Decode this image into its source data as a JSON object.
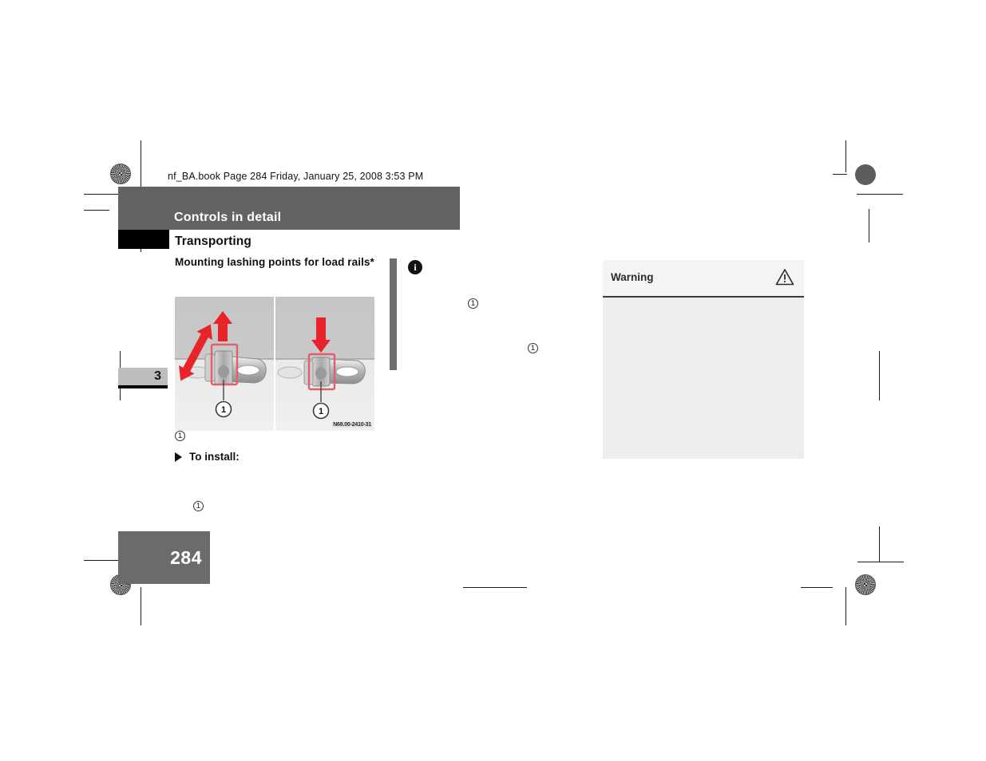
{
  "document": {
    "running_head": "nf_BA.book  Page 284  Friday, January 25, 2008  3:53 PM",
    "chapter_banner_title": "Controls in detail",
    "section_title": "Transporting",
    "chapter_thumb_number": "3",
    "page_number": "284"
  },
  "content": {
    "subheading": "Mounting lashing points for load rails*",
    "figure": {
      "code": "N68.00-2410-31",
      "panels": [
        {
          "name": "tilt-and-lift-panel",
          "callout": "1",
          "arrows": [
            "diagonal-double-arrow",
            "up-arrow"
          ]
        },
        {
          "name": "press-down-panel",
          "callout": "1",
          "arrows": [
            "down-arrow"
          ]
        }
      ]
    },
    "legend_marker": "1",
    "step_label": "To install:",
    "lower_marker": "1"
  },
  "notice": {
    "icon": "i",
    "marker_a": "1",
    "marker_b": "1"
  },
  "warning": {
    "title": "Warning",
    "icon": "warning-triangle-icon"
  },
  "colors": {
    "banner_gray": "#636363",
    "thumb_gray": "#bdbdbd",
    "folio_gray": "#6b6b6b",
    "warning_bg": "#ededed",
    "notice_bar": "#6e6e6e",
    "arrow_red": "#e8232a",
    "highlight_red": "#e0606a"
  }
}
